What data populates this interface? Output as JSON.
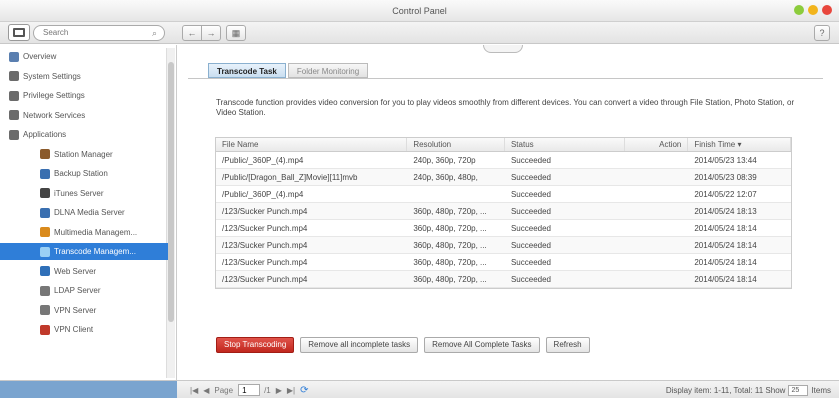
{
  "window": {
    "title": "Control Panel"
  },
  "search": {
    "placeholder": "Search"
  },
  "sidebar": {
    "items": [
      {
        "label": "Overview",
        "level": "top",
        "icon": "overview-icon",
        "color": "#5a7fb0"
      },
      {
        "label": "System Settings",
        "level": "top",
        "icon": "system-settings-icon",
        "color": "#6b6b6b"
      },
      {
        "label": "Privilege Settings",
        "level": "top",
        "icon": "privilege-icon",
        "color": "#6b6b6b"
      },
      {
        "label": "Network Services",
        "level": "top",
        "icon": "network-icon",
        "color": "#6b6b6b"
      },
      {
        "label": "Applications",
        "level": "top",
        "icon": "applications-icon",
        "color": "#6b6b6b"
      },
      {
        "label": "Station Manager",
        "level": "sub",
        "icon": "station-manager-icon",
        "color": "#8b5a2b"
      },
      {
        "label": "Backup Station",
        "level": "sub",
        "icon": "backup-station-icon",
        "color": "#3a6fb0"
      },
      {
        "label": "iTunes Server",
        "level": "sub",
        "icon": "itunes-icon",
        "color": "#444444"
      },
      {
        "label": "DLNA Media Server",
        "level": "sub",
        "icon": "dlna-icon",
        "color": "#3a6fb0"
      },
      {
        "label": "Multimedia Managem...",
        "level": "sub",
        "icon": "multimedia-icon",
        "color": "#d98a1c"
      },
      {
        "label": "Transcode Managem...",
        "level": "sub",
        "icon": "transcode-icon",
        "color": "#9ad0f5",
        "active": true
      },
      {
        "label": "Web Server",
        "level": "sub",
        "icon": "web-server-icon",
        "color": "#2f6fb8"
      },
      {
        "label": "LDAP Server",
        "level": "sub",
        "icon": "ldap-icon",
        "color": "#777777"
      },
      {
        "label": "VPN Server",
        "level": "sub",
        "icon": "vpn-server-icon",
        "color": "#777777"
      },
      {
        "label": "VPN Client",
        "level": "sub",
        "icon": "vpn-client-icon",
        "color": "#c0392b"
      }
    ]
  },
  "tabs": [
    {
      "label": "Transcode Task",
      "active": true
    },
    {
      "label": "Folder Monitoring",
      "active": false
    }
  ],
  "description": "Transcode function provides video conversion for you to play videos smoothly from different devices. You can convert a video through File Station, Photo Station, or Video Station.",
  "table": {
    "headers": [
      "File Name",
      "Resolution",
      "Status",
      "Action",
      "Finish Time"
    ],
    "rows": [
      [
        "/Public/_360P_(4).mp4",
        "240p, 360p, 720p",
        "Succeeded",
        "",
        "2014/05/23 13:44"
      ],
      [
        "/Public/[Dragon_Ball_Z]Movie][11]mvb",
        "240p, 360p, 480p,",
        "Succeeded",
        "",
        "2014/05/23 08:39"
      ],
      [
        "/Public/_360P_(4).mp4",
        "",
        "Succeeded",
        "",
        "2014/05/22 12:07"
      ],
      [
        "/123/Sucker Punch.mp4",
        "360p, 480p, 720p, ...",
        "Succeeded",
        "",
        "2014/05/24 18:13"
      ],
      [
        "/123/Sucker Punch.mp4",
        "360p, 480p, 720p, ...",
        "Succeeded",
        "",
        "2014/05/24 18:14"
      ],
      [
        "/123/Sucker Punch.mp4",
        "360p, 480p, 720p, ...",
        "Succeeded",
        "",
        "2014/05/24 18:14"
      ],
      [
        "/123/Sucker Punch.mp4",
        "360p, 480p, 720p, ...",
        "Succeeded",
        "",
        "2014/05/24 18:14"
      ],
      [
        "/123/Sucker Punch.mp4",
        "360p, 480p, 720p, ...",
        "Succeeded",
        "",
        "2014/05/24 18:14"
      ]
    ]
  },
  "buttons": {
    "stop": "Stop Transcoding",
    "remove_incomplete": "Remove all incomplete tasks",
    "remove_complete": "Remove All Complete Tasks",
    "refresh": "Refresh"
  },
  "pager": {
    "page_label": "Page",
    "page_value": "1",
    "of_label": "/1"
  },
  "display": {
    "text": "Display item: 1-11, Total: 11  Show",
    "show_value": "25",
    "items_label": "Items"
  }
}
